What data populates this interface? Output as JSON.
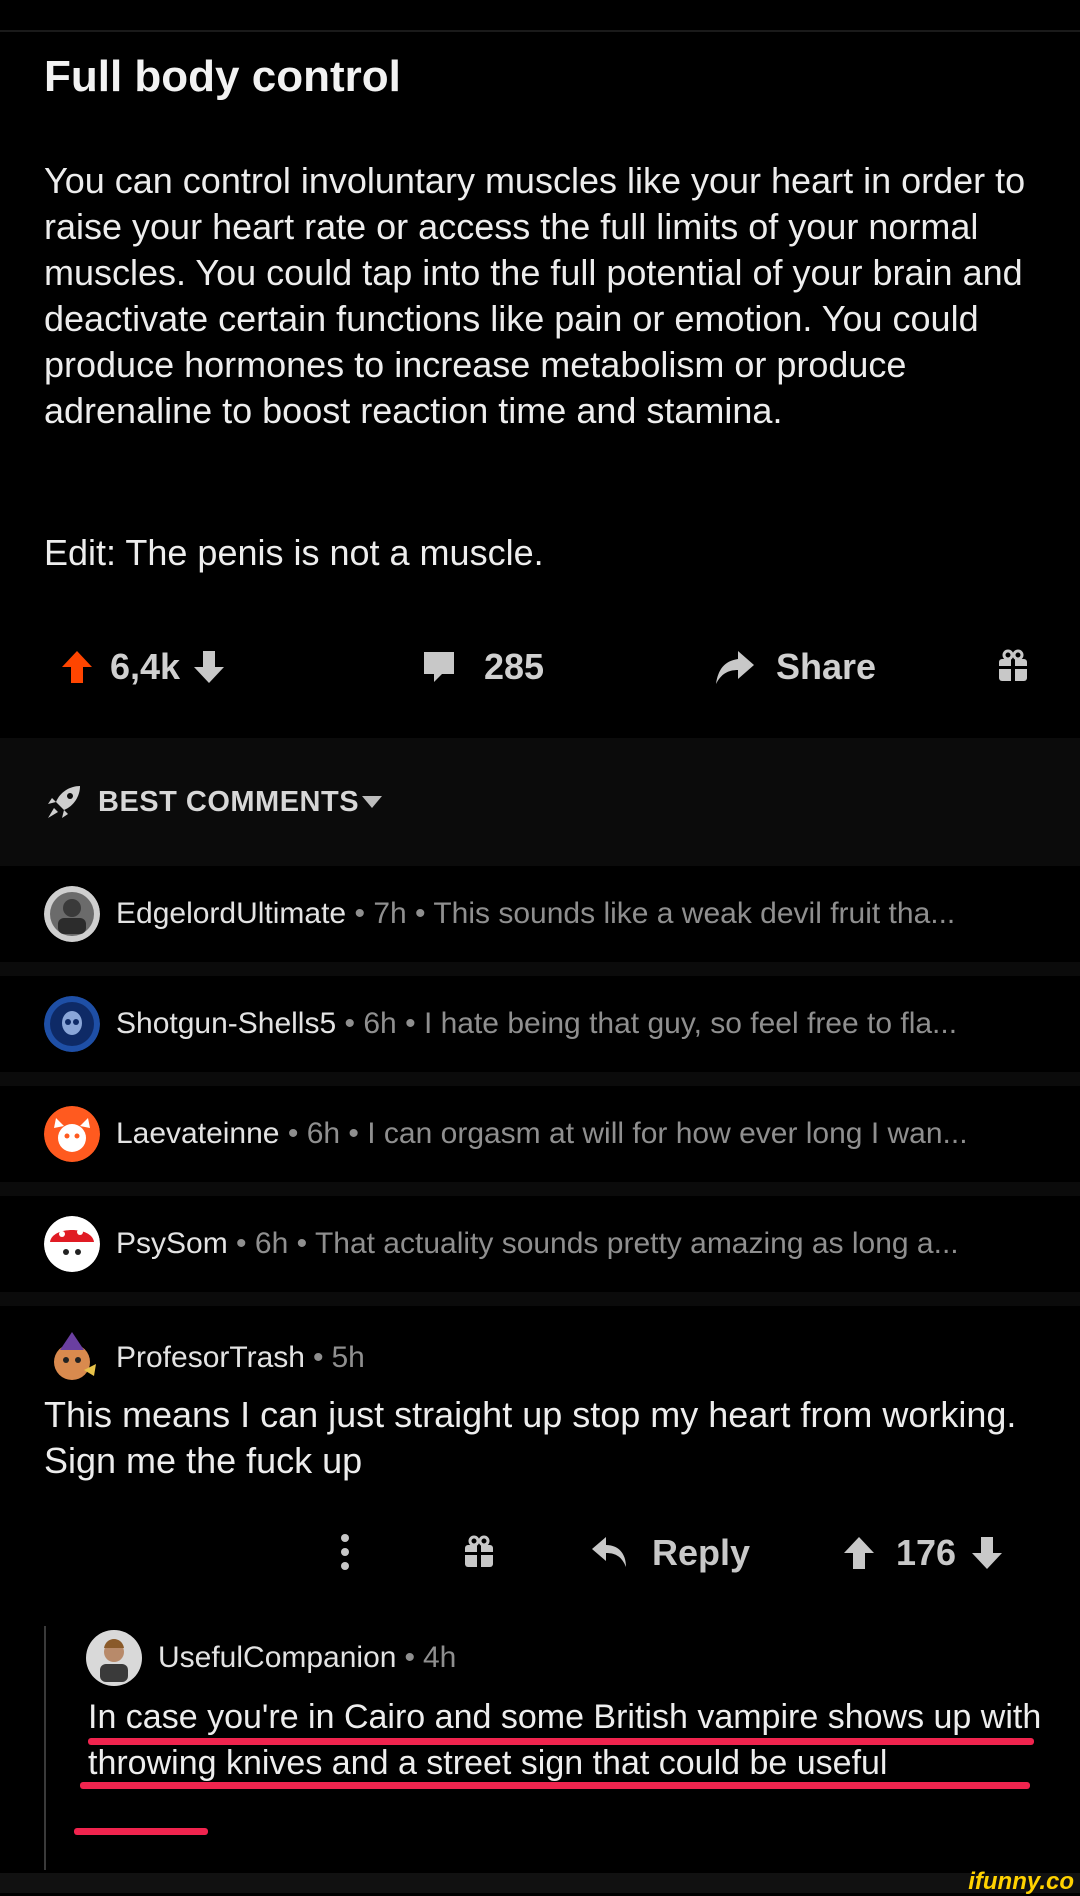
{
  "post": {
    "title": "Full body control",
    "body": "You can control involuntary muscles like your heart in order to raise your heart rate or access the full limits of your normal muscles. You could tap into the full potential of your brain and deactivate certain functions like pain or emotion. You could produce hormones to increase metabolism or produce adrenaline to boost reaction time and stamina.",
    "edit": "Edit: The penis is not a muscle.",
    "votes": "6,4k",
    "comments": "285",
    "share_label": "Share"
  },
  "sort": {
    "label": "BEST COMMENTS"
  },
  "collapsed_comments": [
    {
      "user": "EdgelordUltimate",
      "time": "7h",
      "snippet": "This sounds like a weak devil fruit tha..."
    },
    {
      "user": "Shotgun-Shells5",
      "time": "6h",
      "snippet": "I hate being that guy, so feel free to fla..."
    },
    {
      "user": "Laevateinne",
      "time": "6h",
      "snippet": "I can orgasm at will for how ever long I wan..."
    },
    {
      "user": "PsySom",
      "time": "6h",
      "snippet": "That actuality sounds pretty amazing as long a..."
    }
  ],
  "expanded_comment": {
    "user": "ProfesorTrash",
    "time": "5h",
    "text": "This means I can just straight up stop my heart from working. Sign me the fuck up",
    "reply_label": "Reply",
    "votes": "176"
  },
  "reply": {
    "user": "UsefulCompanion",
    "time": "4h",
    "text": "In case you're in Cairo and some British vampire shows up with throwing knives and a street sign that could be useful"
  },
  "dot": "•",
  "watermark": "ifunny.co",
  "colors": {
    "upvote": "#ff4500",
    "highlight": "#f0244e",
    "background": "#000000"
  }
}
